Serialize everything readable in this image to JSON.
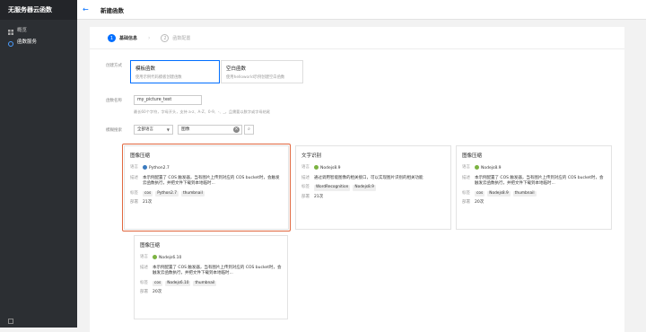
{
  "sidebar": {
    "title": "无服务器云函数",
    "items": [
      {
        "label": "概览",
        "icon": "grid-icon"
      },
      {
        "label": "函数服务",
        "icon": "function-icon"
      }
    ]
  },
  "topbar": {
    "title": "新建函数"
  },
  "steps": [
    {
      "num": "1",
      "label": "基础信息"
    },
    {
      "num": "2",
      "label": "函数配置"
    }
  ],
  "form": {
    "method_label": "创建方式",
    "methods": [
      {
        "title": "模板函数",
        "desc": "使用示例代码模板创建函数"
      },
      {
        "title": "空白函数",
        "desc": "使用helloworld示例创建空白函数"
      }
    ],
    "name_label": "函数名称",
    "name_value": "my_picture_test",
    "name_hint": "最长60个字符，字母开头，支持 a-z、A-Z、0-9、-、_，且需要以数字或字母结尾",
    "search_label": "模糊搜索",
    "lang_select": "全部语言",
    "search_value": "图像"
  },
  "templates": [
    {
      "name": "图像压缩",
      "runtime": "Python2.7",
      "desc": "本示例配置了 COS 触发器，当有图片上传到对应的 COS bucket时，会触发云函数执行，并把文件下载到本地临时...",
      "tags": [
        "cos",
        "Python2.7",
        "thumbnail"
      ],
      "deploys": "21次"
    },
    {
      "name": "文字识别",
      "runtime": "Nodejs8.9",
      "desc": "通过调用智能图像的相关接口，可以实现图片识别的相关功能",
      "tags": [
        "WordRecognition",
        "Nodejs8.9"
      ],
      "deploys": "21次"
    },
    {
      "name": "图像压缩",
      "runtime": "Nodejs8.9",
      "desc": "本示例配置了 COS 触发器，当有图片上传到对应的 COS bucket时，会触发云函数执行，并把文件下载到本地临时...",
      "tags": [
        "cos",
        "Nodejs8.9",
        "thumbnail"
      ],
      "deploys": "20次"
    },
    {
      "name": "图像压缩",
      "runtime": "Nodejs6.10",
      "desc": "本示例配置了 COS 触发器，当有图片上传到对应的 COS bucket时，会触发云函数执行，并把文件下载到本地临时...",
      "tags": [
        "cos",
        "Nodejs6.10",
        "thumbnail"
      ],
      "deploys": "20次"
    }
  ],
  "card_labels": {
    "runtime": "语言",
    "desc": "描述",
    "tags": "标签",
    "deploys": "部署"
  },
  "colors": {
    "accent": "#006eff",
    "highlight": "#e0673e",
    "python": "#3b7bbf",
    "nodejs": "#7cb342"
  }
}
